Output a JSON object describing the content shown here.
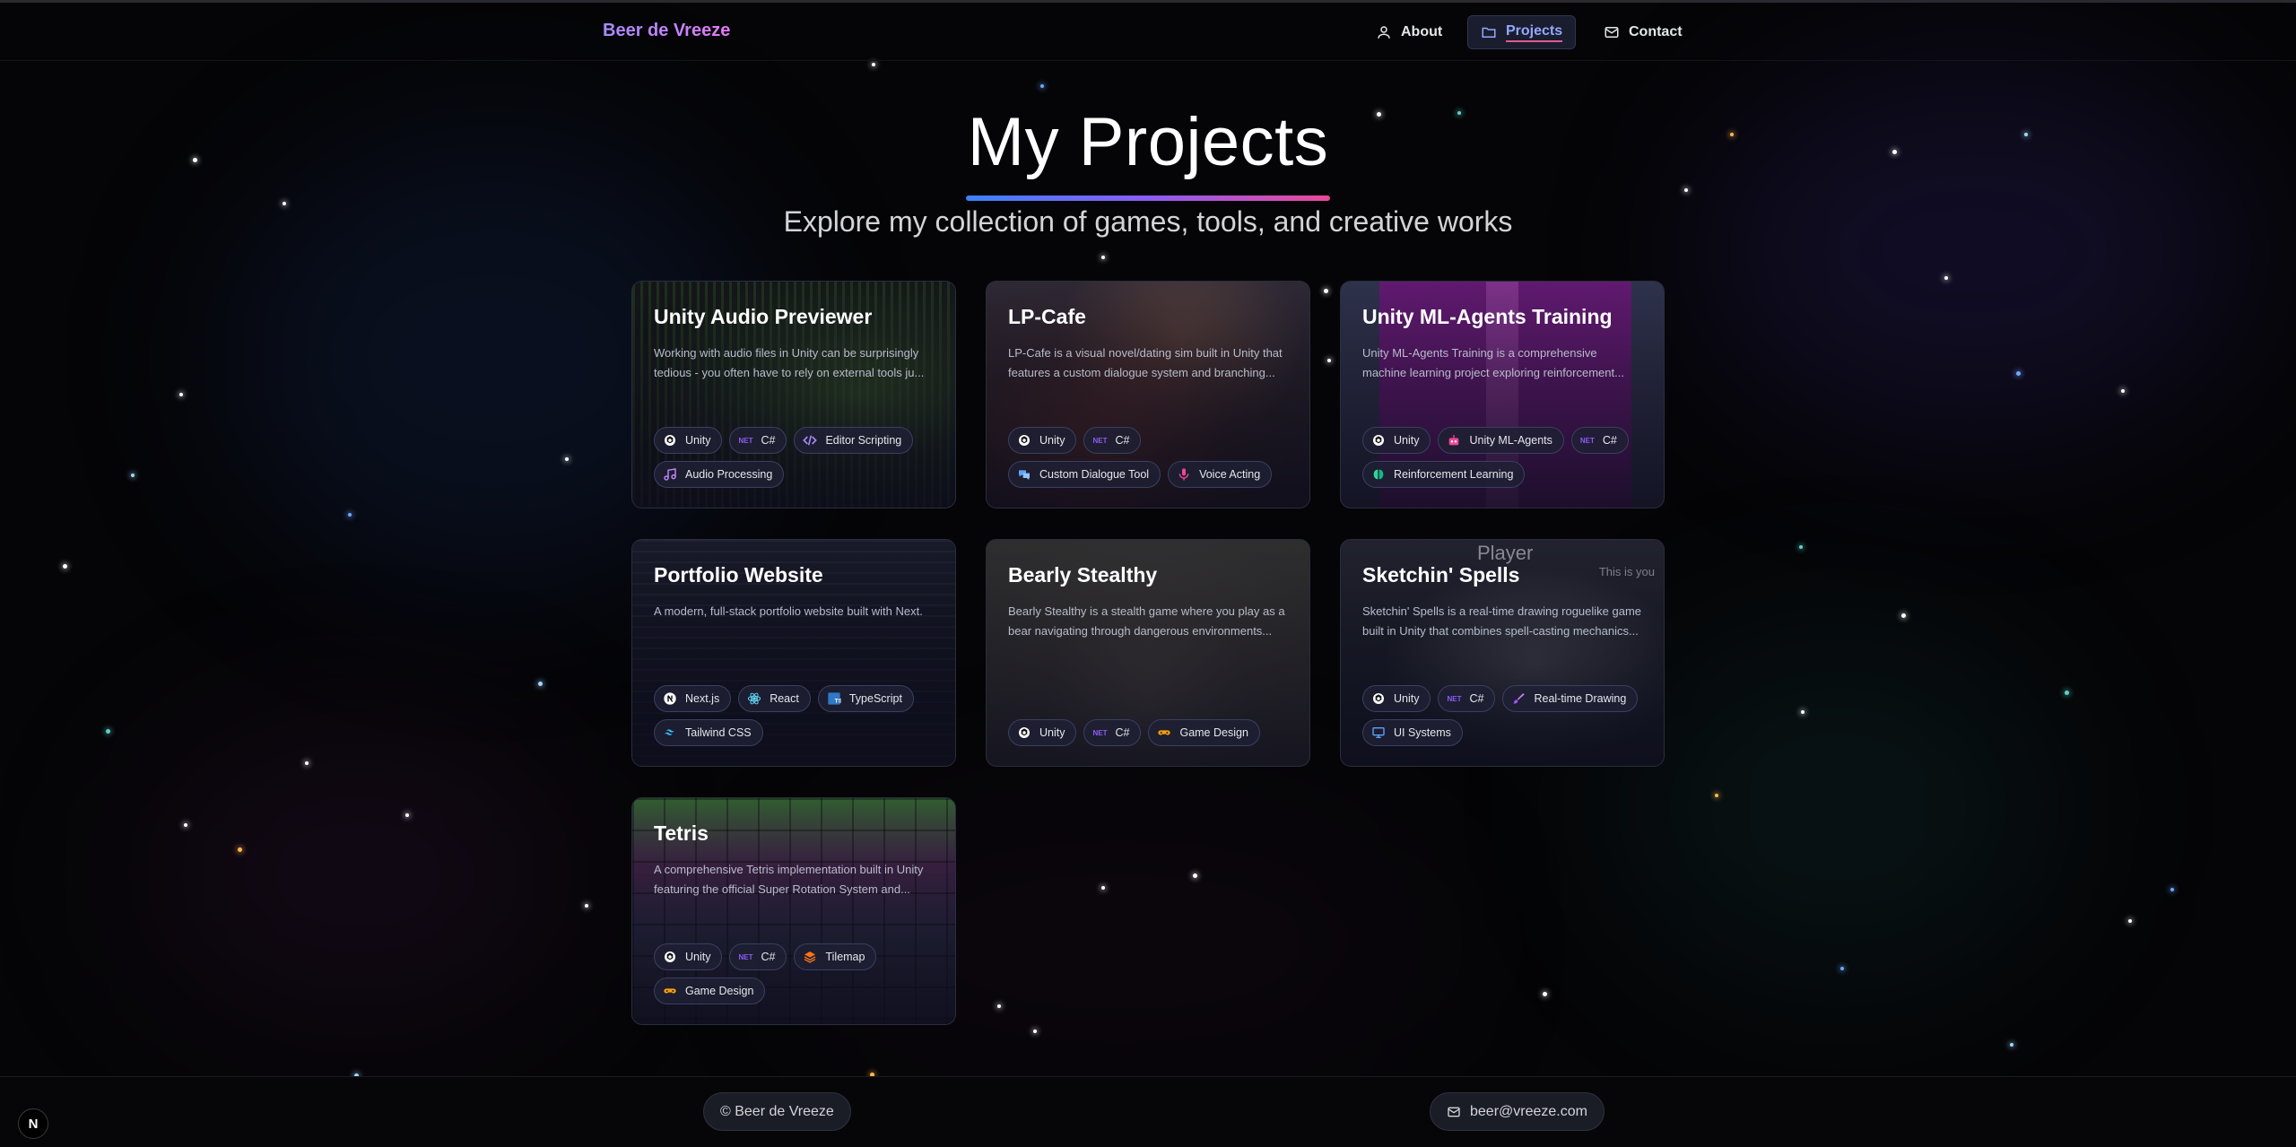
{
  "nav": {
    "brand": "Beer de Vreeze",
    "links": [
      {
        "label": "About",
        "icon": "user-icon"
      },
      {
        "label": "Projects",
        "icon": "folder-icon",
        "active": true
      },
      {
        "label": "Contact",
        "icon": "mail-icon"
      }
    ]
  },
  "header": {
    "title": "My Projects",
    "subtitle": "Explore my collection of games, tools, and creative works"
  },
  "projects": [
    {
      "title": "Unity Audio Previewer",
      "description": "Working with audio files in Unity can be surprisingly tedious - you often have to rely on external tools ju...",
      "tags": [
        "Unity",
        "C#",
        "Editor Scripting",
        "Audio Processing"
      ]
    },
    {
      "title": "LP-Cafe",
      "description": "LP-Cafe is a visual novel/dating sim built in Unity that features a custom dialogue system and branching...",
      "tags": [
        "Unity",
        "C#",
        "Custom Dialogue Tool",
        "Voice Acting"
      ]
    },
    {
      "title": "Unity ML-Agents Training",
      "description": "Unity ML-Agents Training is a comprehensive machine learning project exploring reinforcement...",
      "tags": [
        "Unity",
        "Unity ML-Agents",
        "C#",
        "Reinforcement Learning"
      ]
    },
    {
      "title": "Portfolio Website",
      "description": "A modern, full-stack portfolio website built with Next.",
      "tags": [
        "Next.js",
        "React",
        "TypeScript",
        "Tailwind CSS"
      ]
    },
    {
      "title": "Bearly Stealthy",
      "description": "Bearly Stealthy is a stealth game where you play as a bear navigating through dangerous environments...",
      "tags": [
        "Unity",
        "C#",
        "Game Design"
      ]
    },
    {
      "title": "Sketchin' Spells",
      "description": "Sketchin' Spells is a real-time drawing roguelike game built in Unity that combines spell-casting mechanics...",
      "tags": [
        "Unity",
        "C#",
        "Real-time Drawing",
        "UI Systems"
      ],
      "overlay": {
        "player_label": "Player",
        "hint": "This is you"
      }
    },
    {
      "title": "Tetris",
      "description": "A comprehensive Tetris implementation built in Unity featuring the official Super Rotation System and...",
      "tags": [
        "Unity",
        "C#",
        "Tilemap",
        "Game Design"
      ]
    }
  ],
  "tag_icons": {
    "Unity": "unity-icon",
    "C#": "dotnet-icon",
    "Editor Scripting": "code-icon",
    "Audio Processing": "music-icon",
    "Custom Dialogue Tool": "chat-icon",
    "Voice Acting": "mic-icon",
    "Unity ML-Agents": "robot-icon",
    "Reinforcement Learning": "brain-icon",
    "Next.js": "nextjs-icon",
    "React": "react-icon",
    "TypeScript": "typescript-icon",
    "Tailwind CSS": "tailwind-icon",
    "Game Design": "gamepad-icon",
    "Real-time Drawing": "brush-icon",
    "UI Systems": "monitor-icon",
    "Tilemap": "layers-icon"
  },
  "dotnet_label": "NET",
  "footer": {
    "copyright": "© Beer de Vreeze",
    "email": "beer@vreeze.com"
  },
  "dev_badge": "N",
  "colors": {
    "accent": "#93a8ff",
    "brand_gradient": [
      "#a78bfa",
      "#e879f9"
    ],
    "title_bar_gradient": [
      "#3b82f6",
      "#8b5cf6",
      "#ec4899"
    ]
  }
}
